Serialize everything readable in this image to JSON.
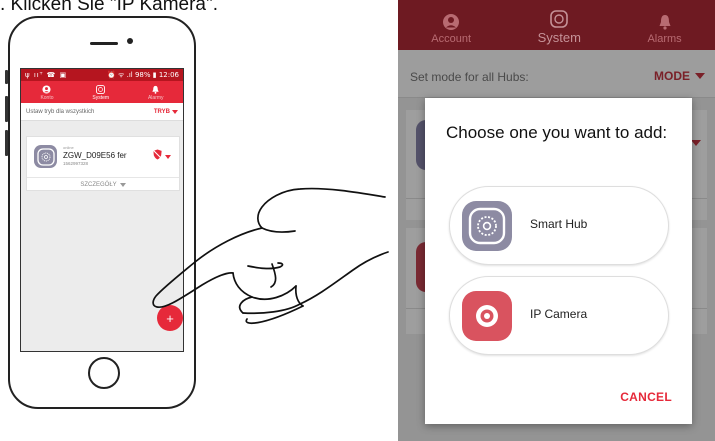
{
  "caption": ". Klicken Sie \"IP Kamera\".",
  "phone": {
    "status_left": "ψ ııᵀ ☎ ▣",
    "status_right": "⏰ ᯤ .ıl 98% ▮ 12:06",
    "nav": [
      {
        "label": "Konto",
        "icon": "account-icon"
      },
      {
        "label": "System",
        "icon": "system-icon"
      },
      {
        "label": "Alarmy",
        "icon": "bell-icon"
      }
    ],
    "mode_label": "Ustaw tryb dla wszystkich",
    "mode_value": "TRYB",
    "hub": {
      "status": "online",
      "name": "ZGW_D09E56 fer",
      "id": "1562997328"
    },
    "details_label": "SZCZEGÓŁY",
    "fab_label": "+"
  },
  "screen": {
    "nav": [
      {
        "label": "Account",
        "icon": "account-icon"
      },
      {
        "label": "System",
        "icon": "system-icon"
      },
      {
        "label": "Alarms",
        "icon": "bell-icon"
      }
    ],
    "mode_label": "Set mode for all Hubs:",
    "mode_value": "MODE",
    "dialog": {
      "title": "Choose one you want to add:",
      "options": [
        {
          "label": "Smart Hub",
          "icon": "smart-hub-icon",
          "color": "#8d8ba3"
        },
        {
          "label": "IP Camera",
          "icon": "ip-camera-icon",
          "color": "#d9535f"
        }
      ],
      "cancel_label": "CANCEL"
    }
  },
  "colors": {
    "accent": "#e6293a",
    "accent_dark": "#b5151f",
    "hub": "#8d8ba3",
    "camera": "#d9535f"
  }
}
